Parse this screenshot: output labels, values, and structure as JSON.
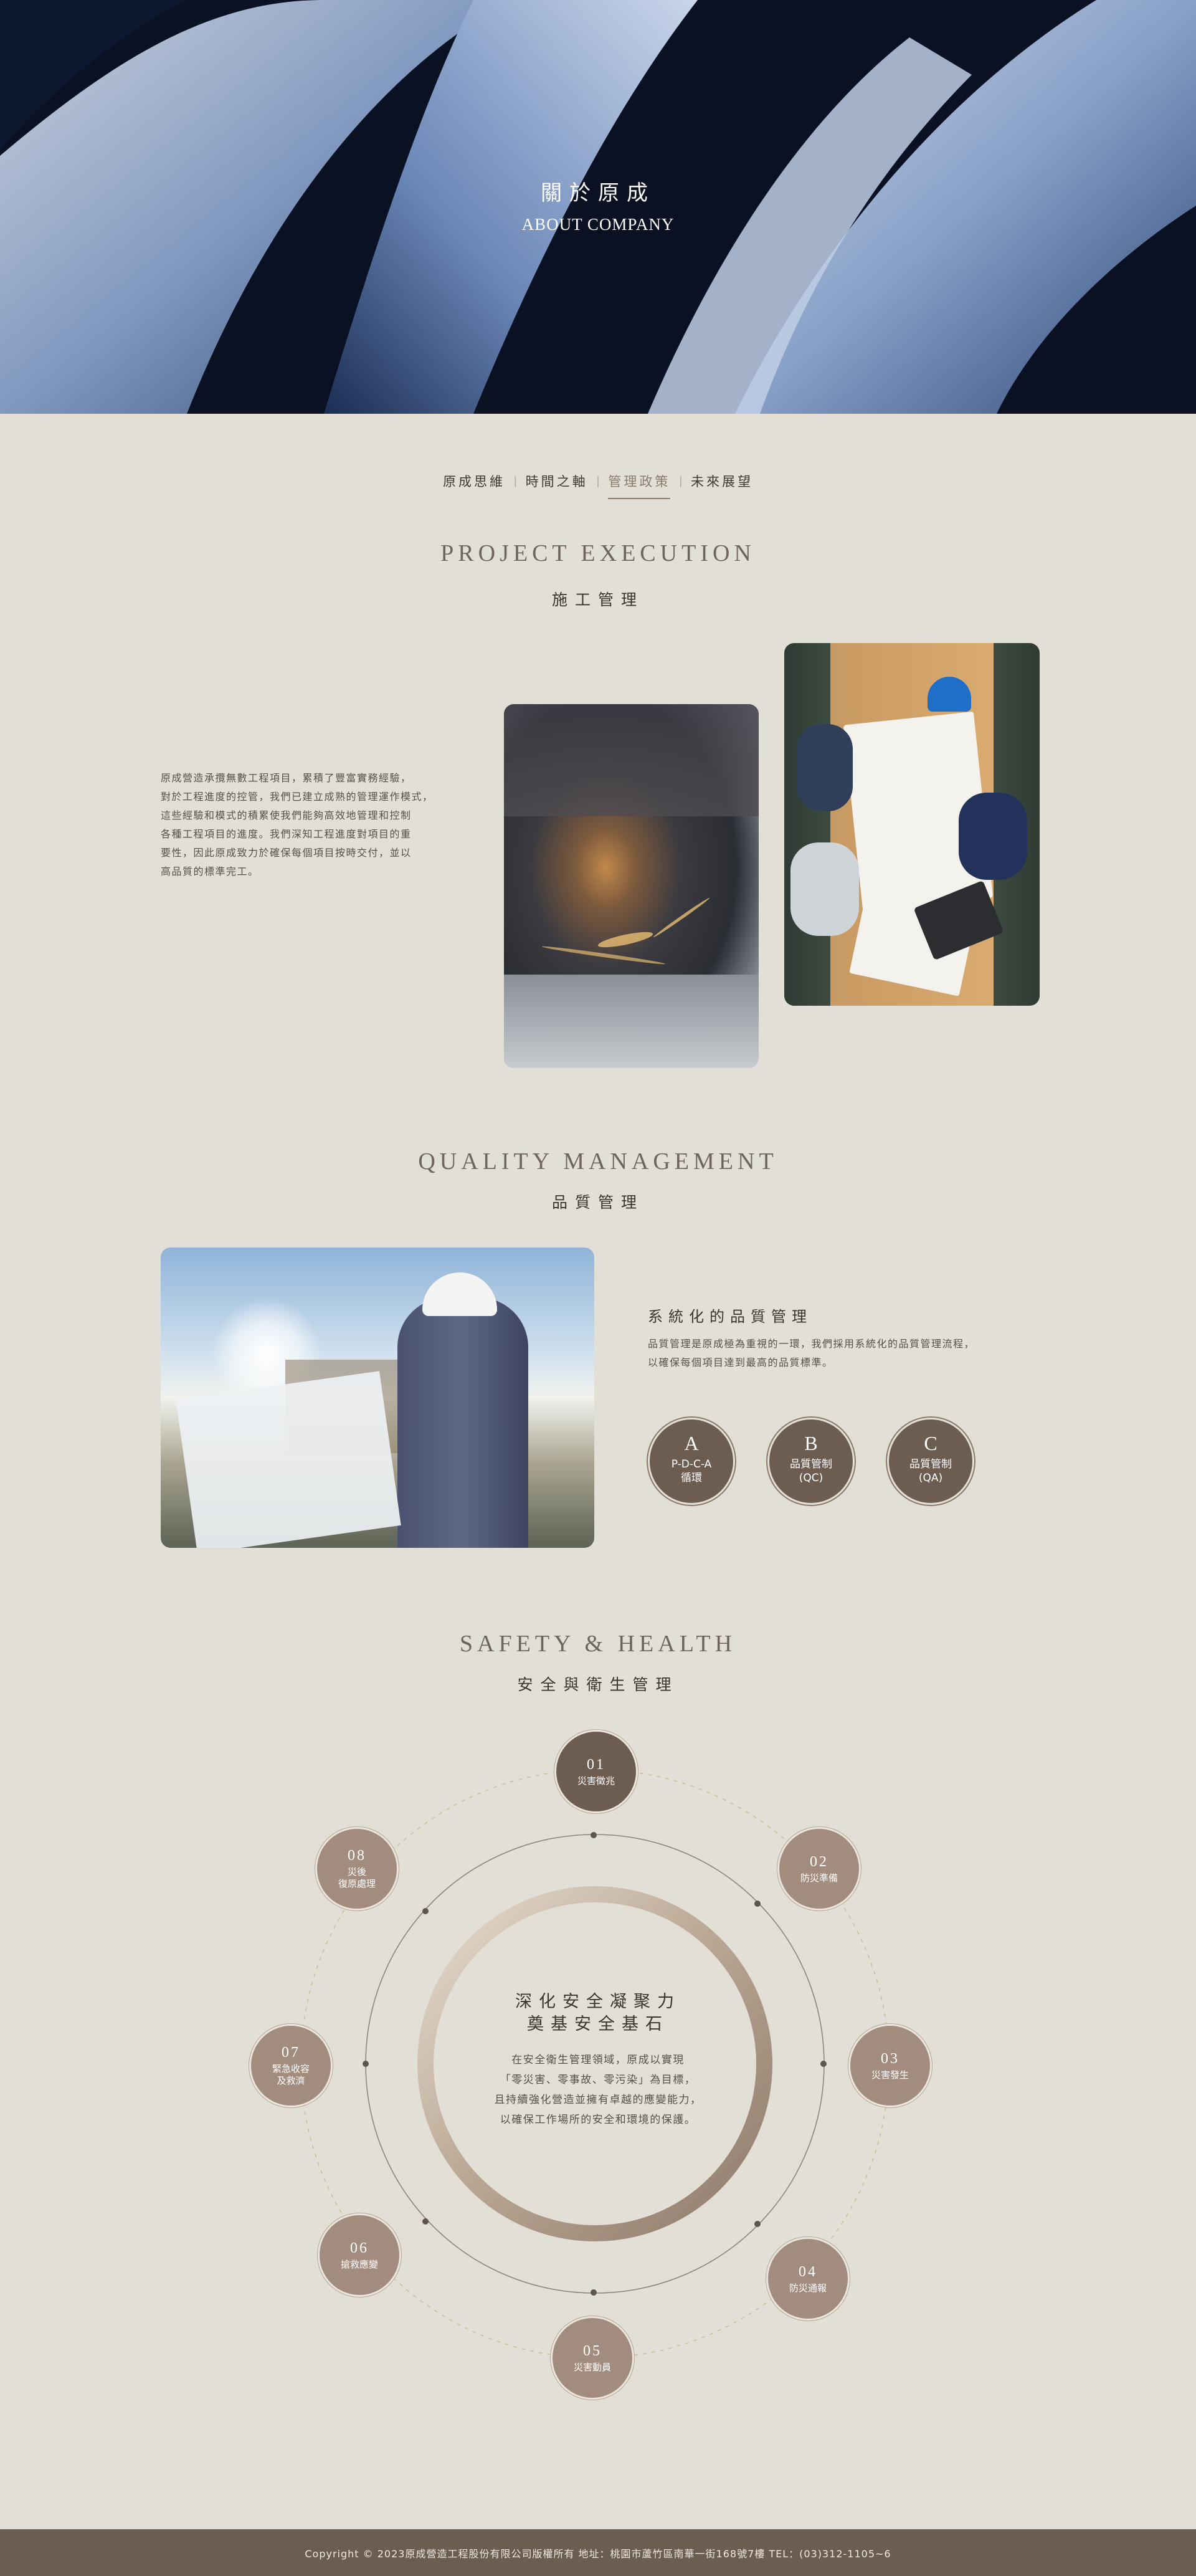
{
  "hero": {
    "title": "關於原成",
    "subtitle": "ABOUT COMPANY"
  },
  "tabs": [
    {
      "label": "原成思維",
      "active": false
    },
    {
      "label": "時間之軸",
      "active": false
    },
    {
      "label": "管理政策",
      "active": true
    },
    {
      "label": "未來展望",
      "active": false
    }
  ],
  "project": {
    "title_en": "PROJECT EXECUTION",
    "title_zh": "施工管理",
    "paragraph_lines": [
      "原成營造承攬無數工程項目，累積了豐富實務經驗，",
      "對於工程進度的控管，我們已建立成熟的管理運作模式，",
      "這些經驗和模式的積累使我們能夠高效地管理和控制",
      "各種工程項目的進度。我們深知工程進度對項目的重",
      "要性，因此原成致力於確保每個項目按時交付，並以",
      "高品質的標準完工。"
    ]
  },
  "quality": {
    "title_en": "QUALITY MANAGEMENT",
    "title_zh": "品質管理",
    "subtitle": "系統化的品質管理",
    "paragraph_lines": [
      "品質管理是原成極為重視的一環，我們採用系統化的品質管理流程，",
      "以確保每個項目達到最高的品質標準。"
    ],
    "items": [
      {
        "letter": "A",
        "label_line1": "P-D-C-A",
        "label_line2": "循環"
      },
      {
        "letter": "B",
        "label_line1": "品質管制",
        "label_line2": "(QC)"
      },
      {
        "letter": "C",
        "label_line1": "品質管制",
        "label_line2": "(QA)"
      }
    ]
  },
  "safety": {
    "title_en": "SAFETY & HEALTH",
    "title_zh": "安全與衛生管理",
    "center_title_line1": "深化安全凝聚力",
    "center_title_line2": "奠基安全基石",
    "center_text_lines": [
      "在安全衛生管理領域，原成以實現",
      "「零災害、零事故、零污染」為目標，",
      "且持續強化營造並擁有卓越的應變能力，",
      "以確保工作場所的安全和環境的保護。"
    ],
    "steps": [
      {
        "num": "01",
        "label": "災害徵兆"
      },
      {
        "num": "02",
        "label": "防災準備"
      },
      {
        "num": "03",
        "label": "災害發生"
      },
      {
        "num": "04",
        "label": "防災通報"
      },
      {
        "num": "05",
        "label": "災害動員"
      },
      {
        "num": "06",
        "label": "搶救應變"
      },
      {
        "num": "07",
        "label": "緊急收容\n及救濟"
      },
      {
        "num": "08",
        "label": "災後\n復原處理"
      }
    ]
  },
  "footer": {
    "text": "Copyright © 2023原成營造工程股份有限公司版權所有  地址：桃園市蘆竹區南華一街168號7樓   TEL：(03)312-1105~6"
  }
}
